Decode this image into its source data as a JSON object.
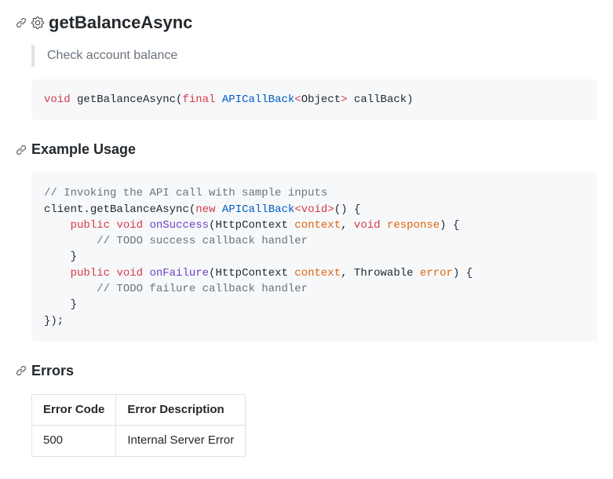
{
  "method": {
    "name": "getBalanceAsync",
    "description": "Check account balance",
    "signature": {
      "return_kw": "void",
      "name": "getBalanceAsync",
      "open": "(",
      "param_kw": "final",
      "param_type": "APICallBack",
      "lt": "<",
      "inner": "Object",
      "gt": ">",
      "param_name": " callBack)",
      "plain_space": " "
    }
  },
  "example": {
    "heading": "Example Usage",
    "lines": {
      "l1_com": "// Invoking the API call with sample inputs",
      "l2_client": "client",
      "l2_dot": ".",
      "l2_call": "getBalanceAsync",
      "l2_paren": "(",
      "l2_new": "new",
      "l2_acb": "APICallBack",
      "l2_lt": "<",
      "l2_void": "void",
      "l2_gt": ">",
      "l2_rest": "() {",
      "l3_ind": "    ",
      "l3_pub": "public",
      "l3_void": "void",
      "l3_fn": "onSuccess",
      "l3_open": "(HttpContext ",
      "l3_ctx": "context",
      "l3_comma": ", ",
      "l3_void2": "void",
      "l3_resp": "response",
      "l3_close": ") {",
      "l4_ind": "        ",
      "l4_com": "// TODO success callback handler",
      "l5_ind": "    ",
      "l5_brace": "}",
      "l6_ind": "    ",
      "l6_pub": "public",
      "l6_void": "void",
      "l6_fn": "onFailure",
      "l6_open": "(HttpContext ",
      "l6_ctx": "context",
      "l6_comma": ", Throwable ",
      "l6_err": "error",
      "l6_close": ") {",
      "l7_ind": "        ",
      "l7_com": "// TODO failure callback handler",
      "l8_ind": "    ",
      "l8_brace": "}",
      "l9": "});"
    }
  },
  "errors": {
    "heading": "Errors",
    "columns": [
      "Error Code",
      "Error Description"
    ],
    "rows": [
      {
        "code": "500",
        "desc": "Internal Server Error"
      }
    ]
  }
}
